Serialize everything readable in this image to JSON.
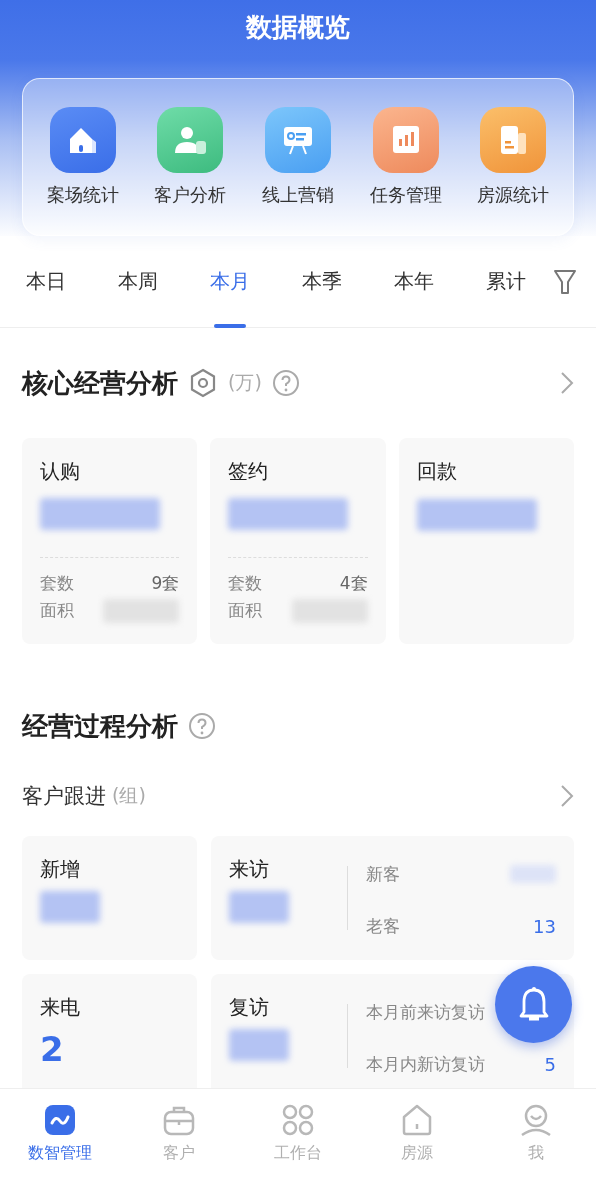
{
  "header": {
    "title": "数据概览"
  },
  "shortcuts": [
    {
      "label": "案场统计",
      "kind": "house"
    },
    {
      "label": "客户分析",
      "kind": "person"
    },
    {
      "label": "线上营销",
      "kind": "board"
    },
    {
      "label": "任务管理",
      "kind": "chart"
    },
    {
      "label": "房源统计",
      "kind": "building"
    }
  ],
  "tabs": [
    {
      "label": "本日",
      "selected": false
    },
    {
      "label": "本周",
      "selected": false
    },
    {
      "label": "本月",
      "selected": true
    },
    {
      "label": "本季",
      "selected": false
    },
    {
      "label": "本年",
      "selected": false
    },
    {
      "label": "累计",
      "selected": false
    }
  ],
  "core": {
    "title": "核心经营分析",
    "unit": "(万)",
    "cards": [
      {
        "title": "认购",
        "hidden": true,
        "details": [
          {
            "label": "套数",
            "value": "9套"
          },
          {
            "label": "面积",
            "hidden": true
          }
        ]
      },
      {
        "title": "签约",
        "hidden": true,
        "details": [
          {
            "label": "套数",
            "value": "4套"
          },
          {
            "label": "面积",
            "hidden": true
          }
        ]
      },
      {
        "title": "回款",
        "hidden": true
      }
    ]
  },
  "process": {
    "title": "经营过程分析",
    "subtitle": "客户跟进",
    "unit": "(组)",
    "cards": [
      {
        "title": "新增",
        "hidden": true
      },
      {
        "title": "来访",
        "hidden": true,
        "details": [
          {
            "label": "新客",
            "hidden": true
          },
          {
            "label": "老客",
            "value": "13"
          }
        ]
      },
      {
        "title": "来电",
        "hidden": false,
        "value": "2"
      },
      {
        "title": "复访",
        "hidden": true,
        "details": [
          {
            "label": "本月前来访复访"
          },
          {
            "label": "本月内新访复访",
            "value": "5"
          }
        ]
      }
    ]
  },
  "nav": [
    {
      "label": "数智管理",
      "kind": "chart",
      "selected": true
    },
    {
      "label": "客户",
      "kind": "bag",
      "selected": false
    },
    {
      "label": "工作台",
      "kind": "grid",
      "selected": false
    },
    {
      "label": "房源",
      "kind": "house",
      "selected": false
    },
    {
      "label": "我",
      "kind": "user",
      "selected": false
    }
  ]
}
